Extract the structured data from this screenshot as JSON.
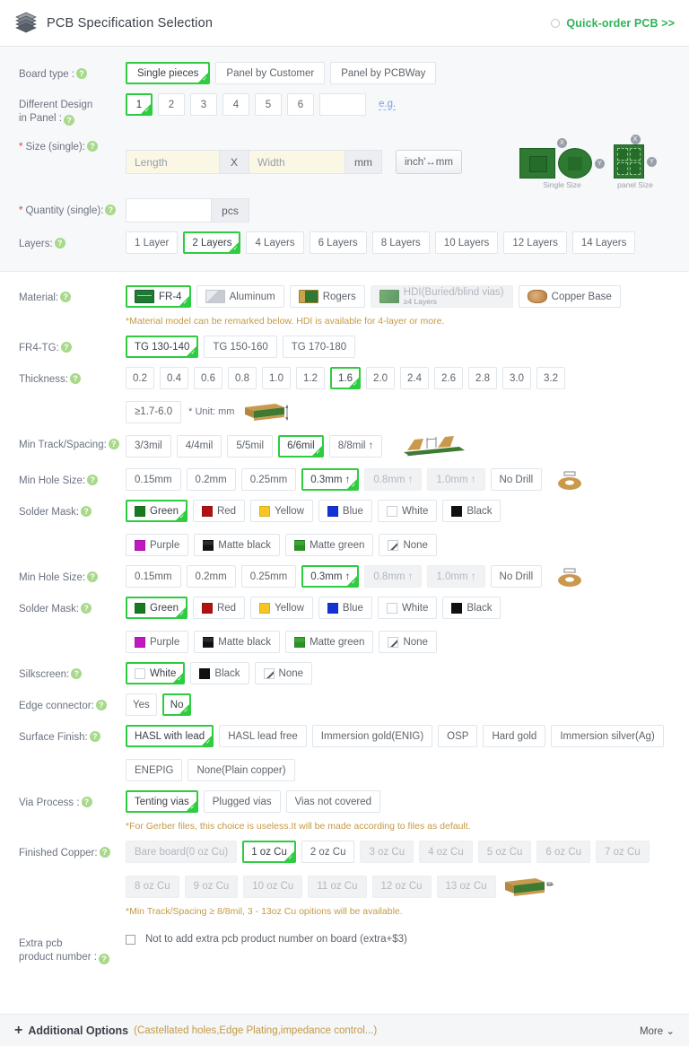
{
  "header": {
    "icon": "pcb-stack-icon",
    "title": "PCB Specification Selection",
    "quick_order": "Quick-order PCB >>"
  },
  "rows": {
    "board_type": {
      "label": "Board type :",
      "options": [
        "Single pieces",
        "Panel by Customer",
        "Panel by PCBWay"
      ],
      "selected": "Single pieces"
    },
    "different_design": {
      "label_line1": "Different Design",
      "label_line2": "in Panel :",
      "options": [
        "1",
        "2",
        "3",
        "4",
        "5",
        "6"
      ],
      "selected": "1",
      "custom_value": "",
      "eg_link": "e.g."
    },
    "size": {
      "label": "Size (single):",
      "required": "*",
      "length_placeholder": "Length",
      "separator": "X",
      "width_placeholder": "Width",
      "unit": "mm",
      "convert_button": "inch'↔mm",
      "pic_single_caption": "Single Size",
      "pic_panel_caption": "panel Size",
      "axis_x": "X",
      "axis_y": "Y"
    },
    "quantity": {
      "label": "Quantity (single):",
      "required": "*",
      "value": "",
      "unit": "pcs"
    },
    "layers": {
      "label": "Layers:",
      "options": [
        "1 Layer",
        "2 Layers",
        "4 Layers",
        "6 Layers",
        "8 Layers",
        "10 Layers",
        "12 Layers",
        "14 Layers"
      ],
      "selected": "2 Layers"
    },
    "material": {
      "label": "Material:",
      "options": [
        {
          "name": "FR-4",
          "sub": "",
          "state": "selected",
          "thumb": "fr4"
        },
        {
          "name": "Aluminum",
          "sub": "",
          "state": "normal",
          "thumb": "alu"
        },
        {
          "name": "Rogers",
          "sub": "",
          "state": "normal",
          "thumb": "rog"
        },
        {
          "name": "HDI(Buried/blind vias)",
          "sub": "≥4 Layers",
          "state": "disabled",
          "thumb": "hdi"
        },
        {
          "name": "Copper Base",
          "sub": "",
          "state": "normal",
          "thumb": "cop"
        }
      ],
      "note": "*Material model can be remarked below. HDI is available for 4-layer or more."
    },
    "fr4_tg": {
      "label": "FR4-TG:",
      "options": [
        "TG 130-140",
        "TG 150-160",
        "TG 170-180"
      ],
      "selected": "TG 130-140"
    },
    "thickness": {
      "label": "Thickness:",
      "options": [
        "0.2",
        "0.4",
        "0.6",
        "0.8",
        "1.0",
        "1.2",
        "1.6",
        "2.0",
        "2.4",
        "2.6",
        "2.8",
        "3.0",
        "3.2"
      ],
      "selected": "1.6",
      "extra_option": "≥1.7-6.0",
      "unit_note": "* Unit: mm"
    },
    "min_track": {
      "label": "Min Track/Spacing:",
      "options": [
        "3/3mil",
        "4/4mil",
        "5/5mil",
        "6/6mil",
        "8/8mil ↑"
      ],
      "selected": "6/6mil"
    },
    "min_hole_1": {
      "label": "Min Hole Size:",
      "options": [
        {
          "name": "0.15mm",
          "state": "normal"
        },
        {
          "name": "0.2mm",
          "state": "normal"
        },
        {
          "name": "0.25mm",
          "state": "normal"
        },
        {
          "name": "0.3mm ↑",
          "state": "selected"
        },
        {
          "name": "0.8mm ↑",
          "state": "disabled"
        },
        {
          "name": "1.0mm ↑",
          "state": "disabled"
        },
        {
          "name": "No Drill",
          "state": "normal"
        }
      ]
    },
    "solder_mask_1": {
      "label": "Solder Mask:",
      "row1": [
        {
          "name": "Green",
          "swatch": "#187a1e",
          "state": "selected"
        },
        {
          "name": "Red",
          "swatch": "#b01212",
          "state": "normal"
        },
        {
          "name": "Yellow",
          "swatch": "#f6c622",
          "state": "normal"
        },
        {
          "name": "Blue",
          "swatch": "#1433d6",
          "state": "normal"
        },
        {
          "name": "White",
          "swatch": "white",
          "state": "normal"
        },
        {
          "name": "Black",
          "swatch": "#111111",
          "state": "normal"
        }
      ],
      "row2": [
        {
          "name": "Purple",
          "swatch": "#c019c0",
          "state": "normal"
        },
        {
          "name": "Matte black",
          "swatch": "matte",
          "state": "normal"
        },
        {
          "name": "Matte green",
          "swatch": "mgreen",
          "state": "normal"
        },
        {
          "name": "None",
          "swatch": "none",
          "state": "normal"
        }
      ]
    },
    "min_hole_2": {
      "label": "Min Hole Size:",
      "options": [
        {
          "name": "0.15mm",
          "state": "normal"
        },
        {
          "name": "0.2mm",
          "state": "normal"
        },
        {
          "name": "0.25mm",
          "state": "normal"
        },
        {
          "name": "0.3mm ↑",
          "state": "selected"
        },
        {
          "name": "0.8mm ↑",
          "state": "disabled"
        },
        {
          "name": "1.0mm ↑",
          "state": "disabled"
        },
        {
          "name": "No Drill",
          "state": "normal"
        }
      ]
    },
    "solder_mask_2": {
      "label": "Solder Mask:",
      "row1": [
        {
          "name": "Green",
          "swatch": "#187a1e",
          "state": "selected"
        },
        {
          "name": "Red",
          "swatch": "#b01212",
          "state": "normal"
        },
        {
          "name": "Yellow",
          "swatch": "#f6c622",
          "state": "normal"
        },
        {
          "name": "Blue",
          "swatch": "#1433d6",
          "state": "normal"
        },
        {
          "name": "White",
          "swatch": "white",
          "state": "normal"
        },
        {
          "name": "Black",
          "swatch": "#111111",
          "state": "normal"
        }
      ],
      "row2": [
        {
          "name": "Purple",
          "swatch": "#c019c0",
          "state": "normal"
        },
        {
          "name": "Matte black",
          "swatch": "matte",
          "state": "normal"
        },
        {
          "name": "Matte green",
          "swatch": "mgreen",
          "state": "normal"
        },
        {
          "name": "None",
          "swatch": "none",
          "state": "normal"
        }
      ]
    },
    "silkscreen": {
      "label": "Silkscreen:",
      "options": [
        {
          "name": "White",
          "swatch": "white",
          "state": "selected"
        },
        {
          "name": "Black",
          "swatch": "#111111",
          "state": "normal"
        },
        {
          "name": "None",
          "swatch": "none",
          "state": "normal"
        }
      ]
    },
    "edge_connector": {
      "label": "Edge connector:",
      "options": [
        "Yes",
        "No"
      ],
      "selected": "No"
    },
    "surface_finish": {
      "label": "Surface Finish:",
      "options": [
        "HASL with lead",
        "HASL lead free",
        "Immersion gold(ENIG)",
        "OSP",
        "Hard gold",
        "Immersion silver(Ag)",
        "ENEPIG",
        "None(Plain copper)"
      ],
      "selected": "HASL with lead"
    },
    "via_process": {
      "label": "Via Process :",
      "options": [
        "Tenting vias",
        "Plugged vias",
        "Vias not covered"
      ],
      "selected": "Tenting vias",
      "note": "*For Gerber files, this choice is useless.It will be made according to files as default."
    },
    "finished_copper": {
      "label": "Finished Copper:",
      "options": [
        {
          "name": "Bare board(0 oz Cu)",
          "state": "disabled"
        },
        {
          "name": "1 oz Cu",
          "state": "selected"
        },
        {
          "name": "2 oz Cu",
          "state": "normal"
        },
        {
          "name": "3 oz Cu",
          "state": "disabled"
        },
        {
          "name": "4 oz Cu",
          "state": "disabled"
        },
        {
          "name": "5 oz Cu",
          "state": "disabled"
        },
        {
          "name": "6 oz Cu",
          "state": "disabled"
        },
        {
          "name": "7 oz Cu",
          "state": "disabled"
        },
        {
          "name": "8 oz Cu",
          "state": "disabled"
        },
        {
          "name": "9 oz Cu",
          "state": "disabled"
        },
        {
          "name": "10 oz Cu",
          "state": "disabled"
        },
        {
          "name": "11 oz Cu",
          "state": "disabled"
        },
        {
          "name": "12 oz Cu",
          "state": "disabled"
        },
        {
          "name": "13 oz Cu",
          "state": "disabled"
        }
      ],
      "note": "*Min Track/Spacing ≥ 8/8mil, 3 - 13oz Cu opitions will be available."
    },
    "extra_pcb": {
      "label_line1": "Extra pcb",
      "label_line2": "product number :",
      "checkbox_label": "Not to add extra pcb product number on board (extra+$3)",
      "checked": false
    }
  },
  "footer": {
    "plus": "+",
    "title": "Additional Options",
    "subtitle": "(Castellated holes,Edge Plating,impedance control...)",
    "more": "More"
  },
  "colors": {
    "accent_green": "#2ecc40",
    "link_green": "#2fb457",
    "note_gold": "#c49a45",
    "required_red": "#e03c3c"
  }
}
